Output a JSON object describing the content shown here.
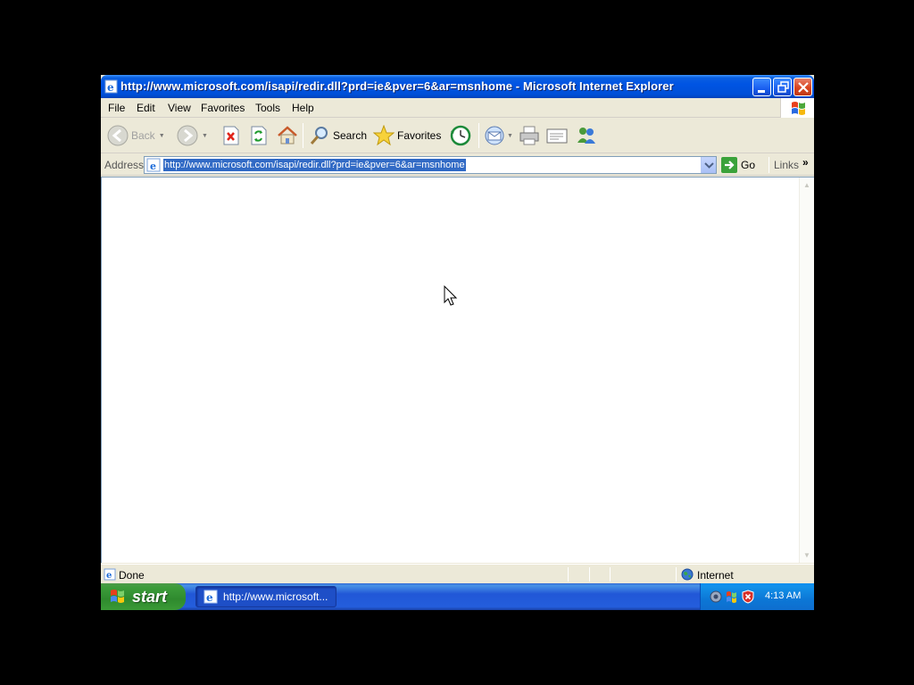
{
  "window": {
    "title": "http://www.microsoft.com/isapi/redir.dll?prd=ie&pver=6&ar=msnhome - Microsoft Internet Explorer"
  },
  "menu": {
    "items": [
      "File",
      "Edit",
      "View",
      "Favorites",
      "Tools",
      "Help"
    ]
  },
  "toolbar": {
    "back_label": "Back",
    "search_label": "Search",
    "favorites_label": "Favorites"
  },
  "address": {
    "label": "Address",
    "url": "http://www.microsoft.com/isapi/redir.dll?prd=ie&pver=6&ar=msnhome",
    "go_label": "Go",
    "links_label": "Links"
  },
  "status": {
    "text": "Done",
    "zone": "Internet"
  },
  "taskbar": {
    "start_label": "start",
    "task_label": "http://www.microsoft...",
    "clock": "4:13 AM"
  },
  "colors": {
    "titlebar_blue": "#0054e3",
    "start_green": "#3c9d3a",
    "selection_blue": "#316ac5",
    "chrome_beige": "#ece9d8"
  }
}
